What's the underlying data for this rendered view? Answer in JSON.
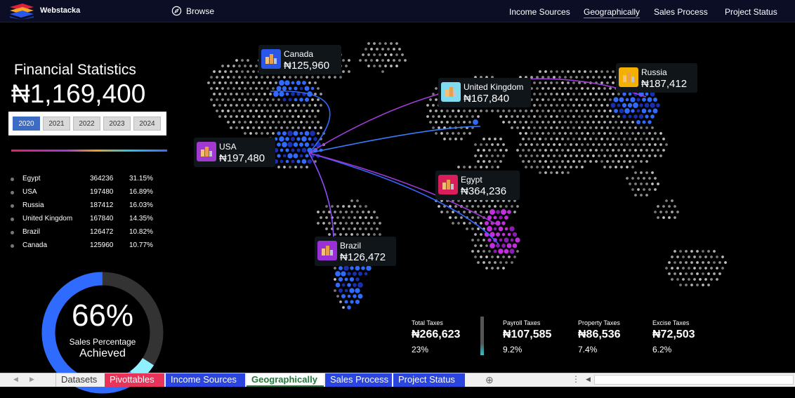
{
  "app": {
    "brand": "Webstacka",
    "browse_label": "Browse"
  },
  "nav": [
    "Income Sources",
    "Geographically",
    "Sales Process",
    "Project Status"
  ],
  "nav_active": "Geographically",
  "summary": {
    "title": "Financial Statistics",
    "total": "₦1,169,400"
  },
  "years": [
    "2020",
    "2021",
    "2022",
    "2023",
    "2024"
  ],
  "selected_year": "2020",
  "stats": [
    {
      "country": "Egypt",
      "value": "364236",
      "pct": "31.15%"
    },
    {
      "country": "USA",
      "value": "197480",
      "pct": "16.89%"
    },
    {
      "country": "Russia",
      "value": "187412",
      "pct": "16.03%"
    },
    {
      "country": "United Kingdom",
      "value": "167840",
      "pct": "14.35%"
    },
    {
      "country": "Brazil",
      "value": "126472",
      "pct": "10.82%"
    },
    {
      "country": "Canada",
      "value": "125960",
      "pct": "10.77%"
    }
  ],
  "donut": {
    "value": 0.66,
    "label_pct": "66%",
    "label1": "Sales Percentage",
    "label2": "Achieved",
    "color_main": "#2f6bff",
    "color_tip": "#8ff0ff",
    "color_track": "#333333"
  },
  "map_cards": [
    {
      "name": "Canada",
      "value": "₦125,960",
      "icon_color": "#2a57e8"
    },
    {
      "name": "United Kingdom",
      "value": "₦167,840",
      "icon_color": "#7fdcf0"
    },
    {
      "name": "Russia",
      "value": "₦187,412",
      "icon_color": "#f4b000"
    },
    {
      "name": "USA",
      "value": "₦197,480",
      "icon_color": "#a03ad0"
    },
    {
      "name": "Egypt",
      "value": "₦364,236",
      "icon_color": "#d81e5b"
    },
    {
      "name": "Brazil",
      "value": "₦126,472",
      "icon_color": "#9b30d8"
    }
  ],
  "taxes": [
    {
      "title": "Total Taxes",
      "amount": "₦266,623",
      "rate": "23%"
    },
    {
      "title": "Payroll Taxes",
      "amount": "₦107,585",
      "rate": "9.2%"
    },
    {
      "title": "Property Taxes",
      "amount": "₦86,536",
      "rate": "7.4%"
    },
    {
      "title": "Excise Taxes",
      "amount": "₦72,503",
      "rate": "6.2%"
    }
  ],
  "sheet_tabs": [
    "Datasets",
    "Pivottables",
    "Income Sources",
    "Geographically",
    "Sales Process",
    "Project Status"
  ],
  "active_sheet": "Geographically",
  "icons": [
    "compass-icon",
    "building-icon",
    "add-sheet-icon",
    "prev-sheet-icon",
    "next-sheet-icon"
  ]
}
